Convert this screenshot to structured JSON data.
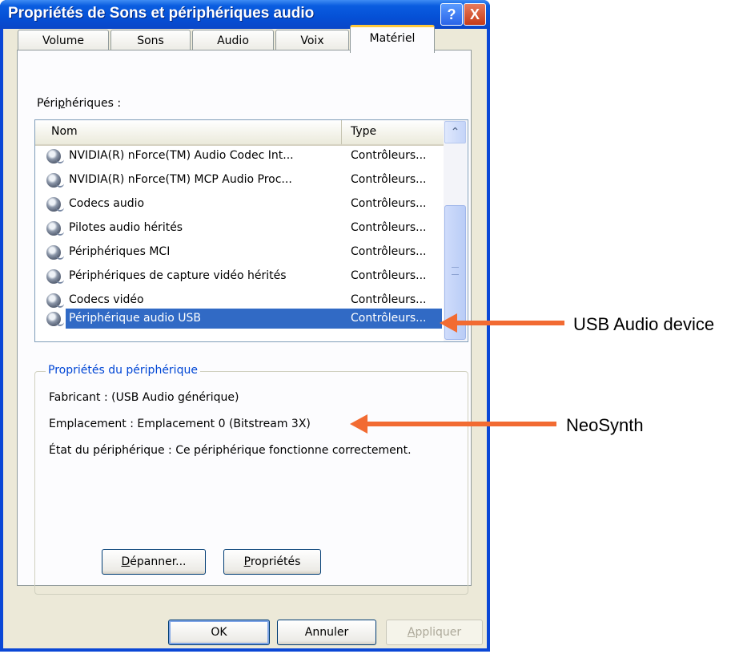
{
  "window": {
    "title": "Propriétés de Sons et périphériques audio",
    "help_label": "?",
    "close_label": "X"
  },
  "tabs": [
    {
      "label": "Volume"
    },
    {
      "label": "Sons"
    },
    {
      "label": "Audio"
    },
    {
      "label": "Voix"
    },
    {
      "label": "Matériel",
      "active": true
    }
  ],
  "devices_label": "Périphériques :",
  "devices_label_parts": [
    "Péri",
    "p",
    "hériques :"
  ],
  "list": {
    "headers": {
      "name": "Nom",
      "type": "Type"
    },
    "rows": [
      {
        "name": "NVIDIA(R) nForce(TM) Audio Codec Int...",
        "type": "Contrôleurs..."
      },
      {
        "name": "NVIDIA(R) nForce(TM) MCP Audio Proc...",
        "type": "Contrôleurs..."
      },
      {
        "name": "Codecs audio",
        "type": "Contrôleurs..."
      },
      {
        "name": "Pilotes audio hérités",
        "type": "Contrôleurs..."
      },
      {
        "name": "Périphériques MCI",
        "type": "Contrôleurs..."
      },
      {
        "name": "Périphériques de capture vidéo hérités",
        "type": "Contrôleurs..."
      },
      {
        "name": "Codecs vidéo",
        "type": "Contrôleurs..."
      },
      {
        "name": "Périphérique audio USB",
        "type": "Contrôleurs...",
        "selected": true
      }
    ]
  },
  "properties": {
    "title": "Propriétés du périphérique",
    "manufacturer": "Fabricant : (USB Audio générique)",
    "location": "Emplacement : Emplacement 0 (Bitstream 3X)",
    "status": "État du périphérique : Ce périphérique fonctionne correctement."
  },
  "buttons": {
    "troubleshoot": {
      "label": "Dépanner...",
      "accel": "D",
      "rest": "épanner..."
    },
    "properties": {
      "label": "Propriétés",
      "accel": "P",
      "rest": "ropriétés"
    },
    "ok": "OK",
    "cancel": "Annuler",
    "apply": {
      "label": "Appliquer",
      "accel": "A",
      "rest": "ppliquer"
    }
  },
  "annotations": {
    "usb": "USB Audio device",
    "neosynth": "NeoSynth",
    "color": "#f26b32"
  }
}
